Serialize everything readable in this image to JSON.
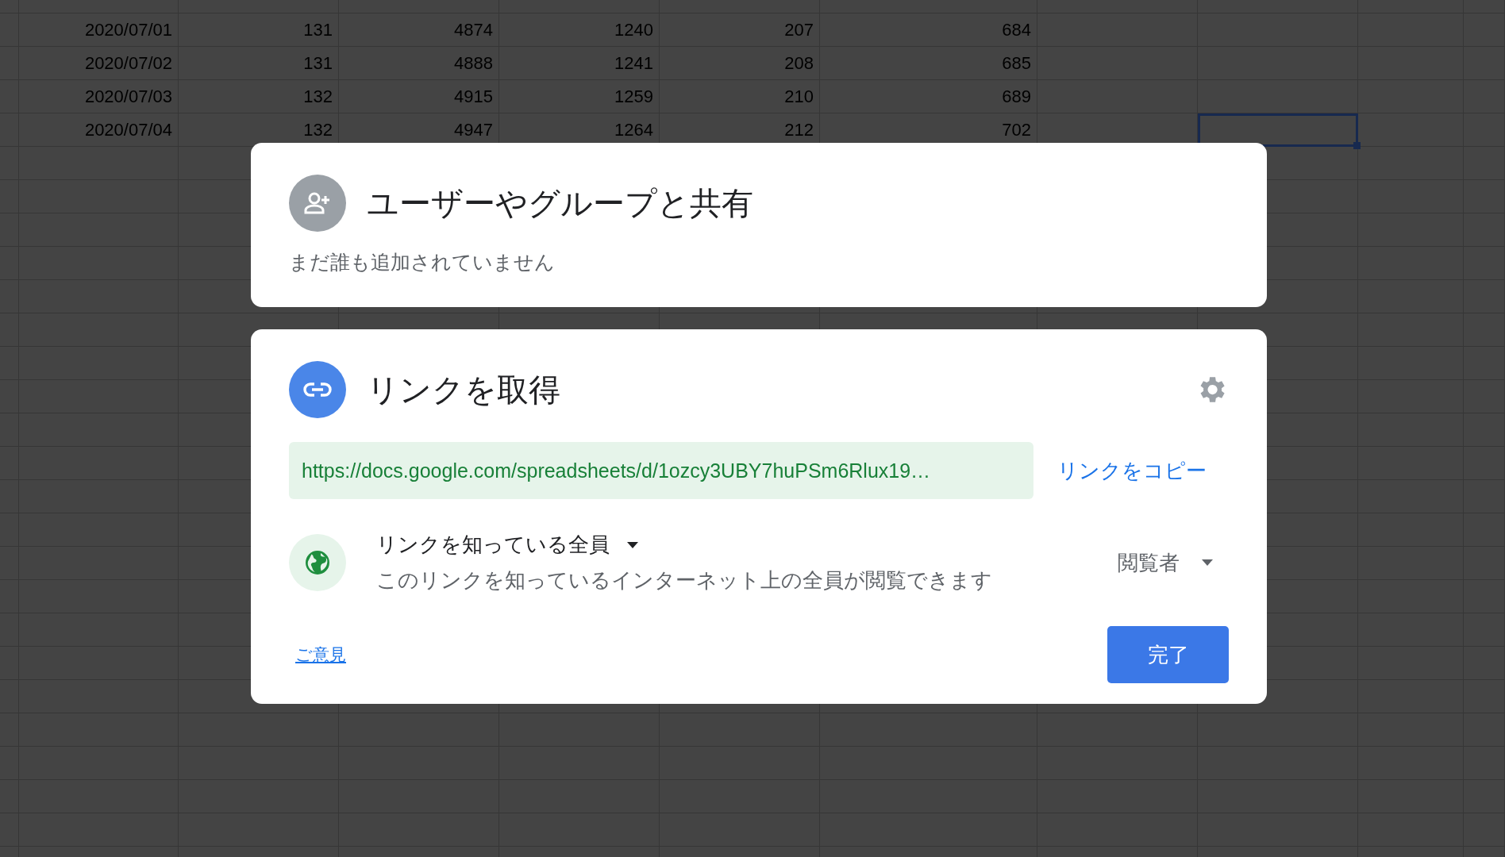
{
  "sheet": {
    "rows": [
      {
        "cells": [
          "2020/07/01",
          "131",
          "4874",
          "1240",
          "207",
          "684"
        ],
        "selected": false
      },
      {
        "cells": [
          "2020/07/02",
          "131",
          "4888",
          "1241",
          "208",
          "685"
        ],
        "selected": false
      },
      {
        "cells": [
          "2020/07/03",
          "132",
          "4915",
          "1259",
          "210",
          "689"
        ],
        "selected": false
      },
      {
        "cells": [
          "2020/07/04",
          "132",
          "4947",
          "1264",
          "212",
          "702"
        ],
        "selected": true
      }
    ]
  },
  "share_people": {
    "title": "ユーザーやグループと共有",
    "status": "まだ誰も追加されていません"
  },
  "get_link": {
    "title": "リンクを取得",
    "url": "https://docs.google.com/spreadsheets/d/1ozcy3UBY7huPSm6Rlux19…",
    "copy_link": "リンクをコピー",
    "access": {
      "scope": "リンクを知っている全員",
      "description": "このリンクを知っているインターネット上の全員が閲覧できます",
      "role": "閲覧者"
    },
    "feedback": "ご意見",
    "done": "完了"
  }
}
